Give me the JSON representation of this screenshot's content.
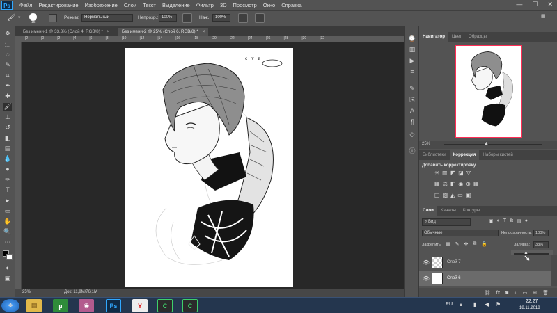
{
  "app": {
    "logo": "Ps"
  },
  "menu": {
    "items": [
      "Файл",
      "Редактирование",
      "Изображение",
      "Слои",
      "Текст",
      "Выделение",
      "Фильтр",
      "3D",
      "Просмотр",
      "Окно",
      "Справка"
    ]
  },
  "window_controls": {
    "minimize": "—",
    "maximize": "☐",
    "close": "✕"
  },
  "options": {
    "brush_size": "15",
    "mode_label": "Режим:",
    "mode_value": "Нормальный",
    "opacity_label": "Непрозр.:",
    "opacity_value": "100%",
    "pressure_label": "Наж.:",
    "pressure_value": "100%"
  },
  "tabs": [
    {
      "label": "Без имени-1 @ 33,3% (Слой 4, RGB/8) *",
      "close": "×"
    },
    {
      "label": "Без имени-2 @ 25% (Слой 6, RGB/8) *",
      "close": "×"
    }
  ],
  "ruler": {
    "top": [
      "|2",
      "|0",
      "|2",
      "|4",
      "|6",
      "|8",
      "|10",
      "|12",
      "|14",
      "|16",
      "|18",
      "|20",
      "|22",
      "|24",
      "|26",
      "|28",
      "|30",
      "|32"
    ]
  },
  "status": {
    "zoom": "25%",
    "doc": "Док: 11,9M/76,1M"
  },
  "canvas": {
    "note": "ᴄ ᴠ ᴇ"
  },
  "navigator": {
    "tabs": [
      "Навигатор",
      "Цвет",
      "Образцы"
    ],
    "zoom": "25%"
  },
  "adjustments": {
    "tabs": [
      "Библиотеки",
      "Коррекция",
      "Наборы кистей"
    ],
    "title": "Добавить корректировку"
  },
  "layers_panel": {
    "tabs": [
      "Слои",
      "Каналы",
      "Контуры"
    ],
    "filter_label": "Вид",
    "blend_mode": "Обычные",
    "opacity_label": "Непрозрачность:",
    "opacity_value": "100%",
    "lock_label": "Закрепить:",
    "fill_label": "Заливка:",
    "fill_value": "33%",
    "layers": [
      {
        "name": "Слой 7"
      },
      {
        "name": "Слой 6"
      }
    ]
  },
  "taskbar": {
    "lang": "RU",
    "time": "22:27",
    "date": "18.11.2018"
  },
  "colors": {
    "accent": "#31a8ff",
    "selected_layer": "#6b6b6b",
    "nav_frame": "#ff2d55"
  }
}
